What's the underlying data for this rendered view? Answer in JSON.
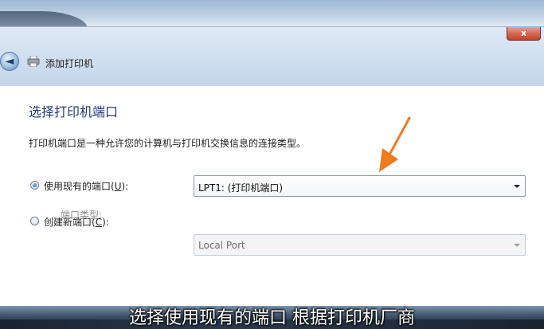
{
  "window": {
    "title": "添加打印机",
    "close_label": "x",
    "back_label": "◄"
  },
  "content": {
    "heading": "选择打印机端口",
    "description": "打印机端口是一种允许您的计算机与打印机交换信息的连接类型。"
  },
  "options": {
    "use_existing": {
      "label_pre": "使用现有的端口(",
      "accel": "U",
      "label_post": "):",
      "checked": true
    },
    "create_new": {
      "label_pre": "创建新端口(",
      "accel": "C",
      "label_post": "):",
      "checked": false
    }
  },
  "existing_port": {
    "selected": "LPT1: (打印机端口)"
  },
  "new_port": {
    "type_label": "端口类型:",
    "selected": "Local Port"
  },
  "caption": "选择使用现有的端口 根据打印机厂商",
  "colors": {
    "heading": "#1d3a78",
    "annotation_arrow": "#f07a1e",
    "close_button": "#c2432c"
  }
}
